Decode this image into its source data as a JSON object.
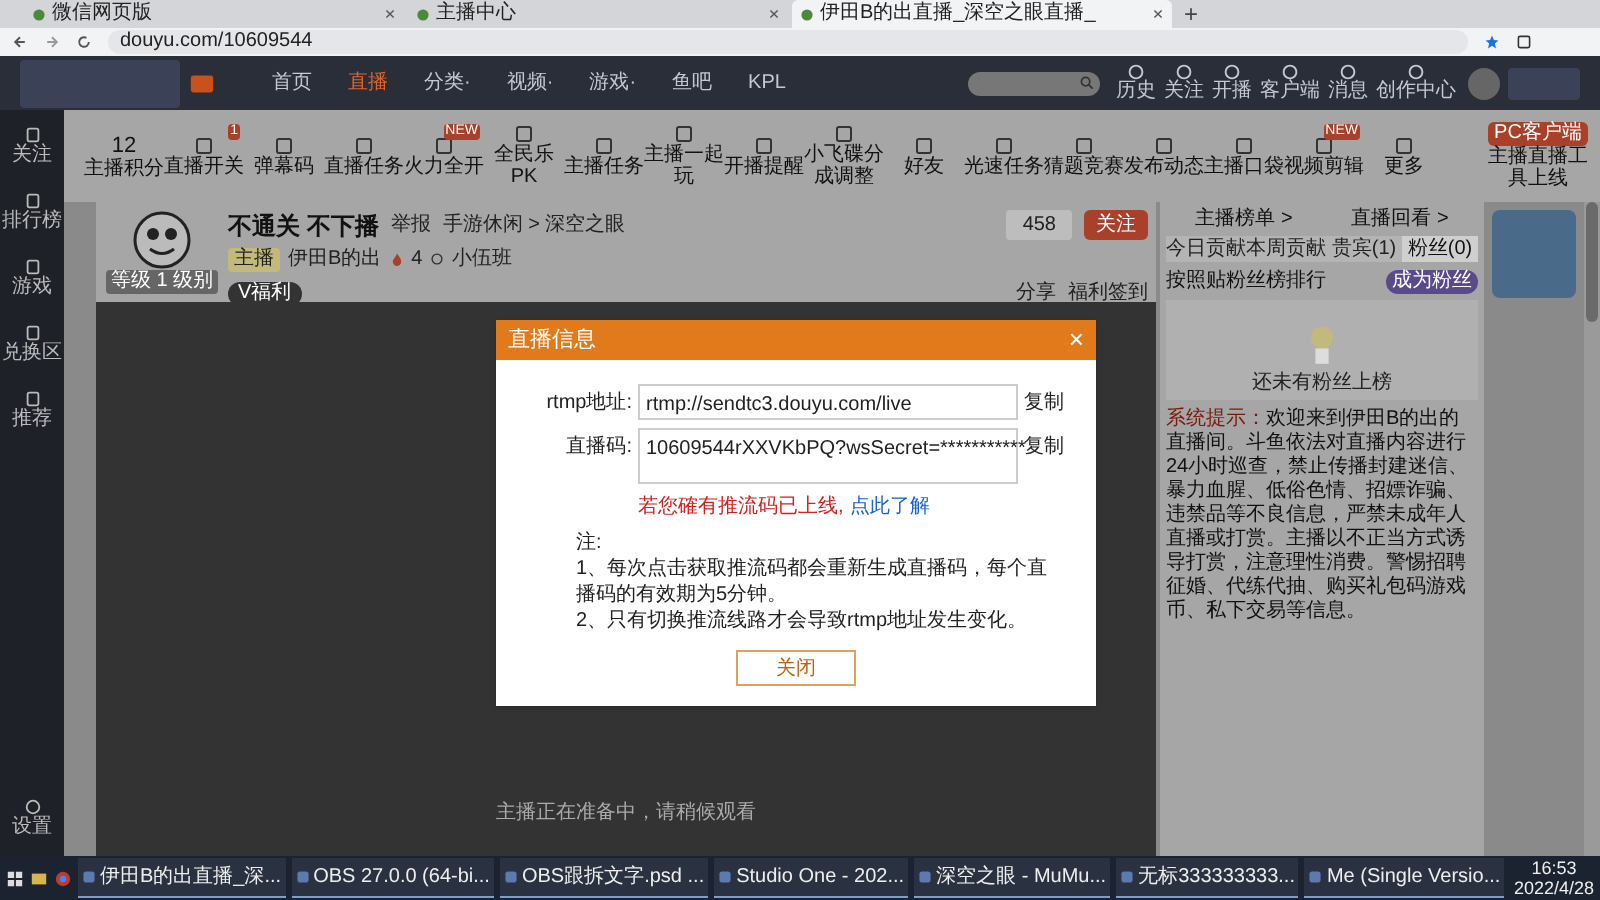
{
  "browser": {
    "tabs": [
      {
        "title": "微信网页版",
        "selected": false
      },
      {
        "title": "主播中心",
        "selected": false
      },
      {
        "title": "伊田B的出直播_深空之眼直播_",
        "selected": true
      }
    ],
    "new_tab": "+",
    "url": "douyu.com/10609544"
  },
  "site_nav": {
    "items": [
      {
        "label": "首页",
        "selected": false
      },
      {
        "label": "直播",
        "selected": true
      },
      {
        "label": "分类·",
        "selected": false
      },
      {
        "label": "视频·",
        "selected": false
      },
      {
        "label": "游戏·",
        "selected": false
      },
      {
        "label": "鱼吧",
        "selected": false
      },
      {
        "label": "KPL",
        "selected": false
      }
    ],
    "actions": [
      "历史",
      "关注",
      "开播",
      "客户端",
      "消息",
      "创作中心"
    ]
  },
  "left_sidebar": {
    "items": [
      "关注",
      "排行榜",
      "游戏",
      "兑换区",
      "推荐"
    ],
    "bottom": "设置"
  },
  "toolbar": {
    "score": "12",
    "score_label": "主播积分",
    "items": [
      {
        "label": "直播开关",
        "badge": "1"
      },
      {
        "label": "弹幕码"
      },
      {
        "label": "直播任务"
      },
      {
        "label": "火力全开",
        "badge": "NEW"
      },
      {
        "label": "全民乐PK"
      },
      {
        "label": "主播任务"
      },
      {
        "label": "主播一起玩"
      },
      {
        "label": "开播提醒"
      },
      {
        "label": "小飞碟分成调整"
      },
      {
        "label": "好友"
      },
      {
        "label": "光速任务"
      },
      {
        "label": "猜题竞赛"
      },
      {
        "label": "发布动态"
      },
      {
        "label": "主播口袋"
      },
      {
        "label": "视频剪辑",
        "badge": "NEW"
      },
      {
        "label": "更多"
      }
    ],
    "client_button": "PC客户端",
    "client_note": "主播直播工具上线"
  },
  "room": {
    "title": "不通关 不下播",
    "report": "举报",
    "category": "手游休闲 > 深空之眼",
    "tag": "主播",
    "anchor": "伊田B的出",
    "heat": "4",
    "guild": "小伍班",
    "avatar_label": "等级 1 级别",
    "vip": "V福利",
    "followers": "458",
    "follow": "关注",
    "share": "分享",
    "checkin": "福利签到",
    "status": "主播正在准备中，请稍候观看"
  },
  "dialog": {
    "title": "直播信息",
    "close": "×",
    "fields": [
      {
        "label": "rtmp地址:",
        "value": "rtmp://sendtc3.douyu.com/live",
        "copy": "复制"
      },
      {
        "label": "直播码:",
        "value": "10609544rXXVKbPQ?wsSecret=***********",
        "copy": "复制"
      }
    ],
    "warning": "若您確有推流码已上线,",
    "link": "点此了解",
    "notes": [
      "注:",
      "1、每次点击获取推流码都会重新生成直播码，每个直播码的有效期为5分钟。",
      "2、只有切换推流线路才会导致rtmp地址发生变化。"
    ],
    "button": "关闭"
  },
  "right_panel": {
    "links": [
      "主播榜单 >",
      "直播回看 >"
    ],
    "tabs": [
      {
        "label": "今日贡献",
        "selected": false
      },
      {
        "label": "本周贡献",
        "selected": false
      },
      {
        "label": "贵宾(1)",
        "selected": false
      },
      {
        "label": "粉丝(0)",
        "selected": true
      }
    ],
    "rank_note": "按照贴粉丝榜排行",
    "fan_button": "成为粉丝",
    "empty": "还未有粉丝上榜",
    "system_label": "系统提示：",
    "system_text": "欢迎来到伊田B的出的直播间。斗鱼依法对直播内容进行24小时巡查，禁止传播封建迷信、暴力血腥、低俗色情、招嫖诈骗、违禁品等不良信息，严禁未成年人直播或打赏。主播以不正当方式诱导打赏，注意理性消费。警惕招聘征婚、代练代抽、购买礼包码游戏币、私下交易等信息。"
  },
  "taskbar": {
    "apps": [
      "伊田B的出直播_深...",
      "OBS 27.0.0 (64-bi...",
      "OBS跟拆文字.psd ...",
      "Studio One - 202...",
      "深空之眼 - MuMu...",
      "无标333333333...",
      "Me (Single Versio..."
    ],
    "time": "16:53",
    "date": "2022/4/28"
  }
}
